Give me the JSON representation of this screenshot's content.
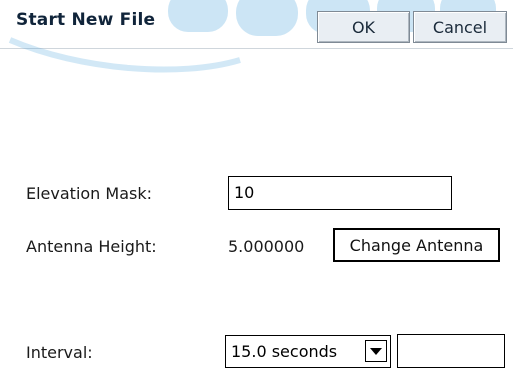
{
  "dialog": {
    "title": "Start New File",
    "ok_label": "OK",
    "cancel_label": "Cancel"
  },
  "form": {
    "elevation_mask_label": "Elevation Mask:",
    "elevation_mask_value": "10",
    "antenna_height_label": "Antenna Height:",
    "antenna_height_value": "5.000000",
    "change_antenna_label": "Change Antenna",
    "interval_label": "Interval:",
    "interval_selected": "15.0 seconds",
    "interval_custom_value": ""
  },
  "colors": {
    "title_text": "#10243a",
    "button_face": "#e9eef3",
    "watermark": "#4aa3dc"
  }
}
